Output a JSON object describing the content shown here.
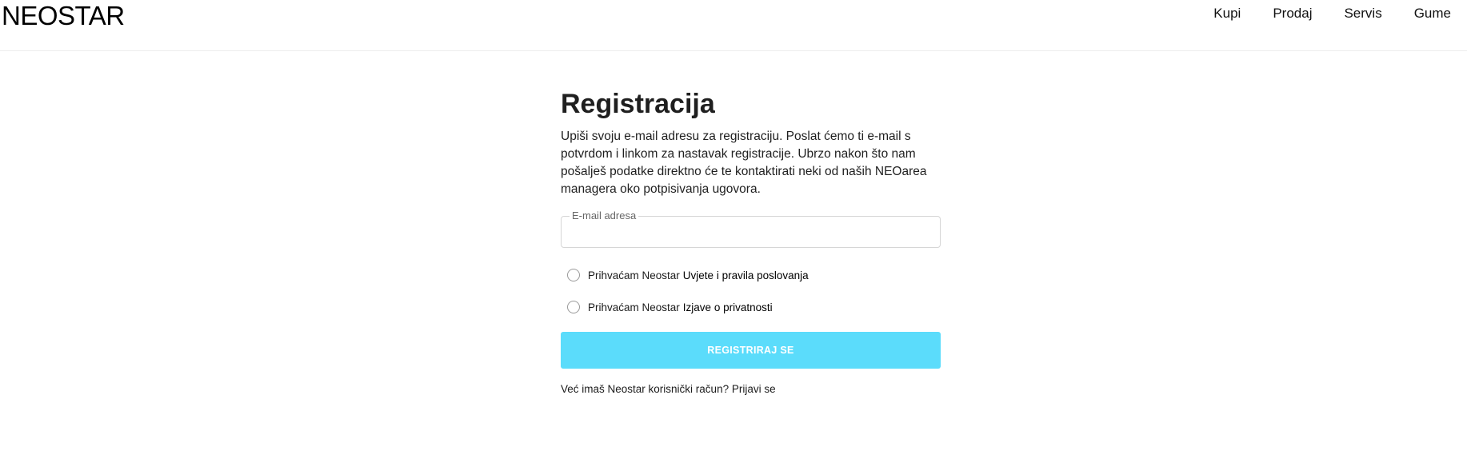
{
  "header": {
    "logo": "NEOSTAR",
    "nav": [
      {
        "label": "Kupi"
      },
      {
        "label": "Prodaj"
      },
      {
        "label": "Servis"
      },
      {
        "label": "Gume"
      }
    ]
  },
  "form": {
    "title": "Registracija",
    "description": "Upiši svoju e-mail adresu za registraciju. Poslat ćemo ti e-mail s potvrdom i linkom za nastavak registracije. Ubrzo nakon što nam pošalješ podatke direktno će te kontaktirati neki od naših NEOarea managera oko potpisivanja ugovora.",
    "email": {
      "label": "E-mail adresa",
      "value": ""
    },
    "checkboxes": [
      {
        "prefix": "Prihvaćam Neostar",
        "link": "Uvjete i pravila poslovanja",
        "checked": false
      },
      {
        "prefix": "Prihvaćam Neostar",
        "link": "Izjave o privatnosti",
        "checked": false
      }
    ],
    "submit_label": "REGISTRIRAJ SE",
    "submit_color": "#5bdcfb",
    "footer_text": "Već imaš Neostar korisnički račun?",
    "footer_link": "Prijavi se"
  }
}
